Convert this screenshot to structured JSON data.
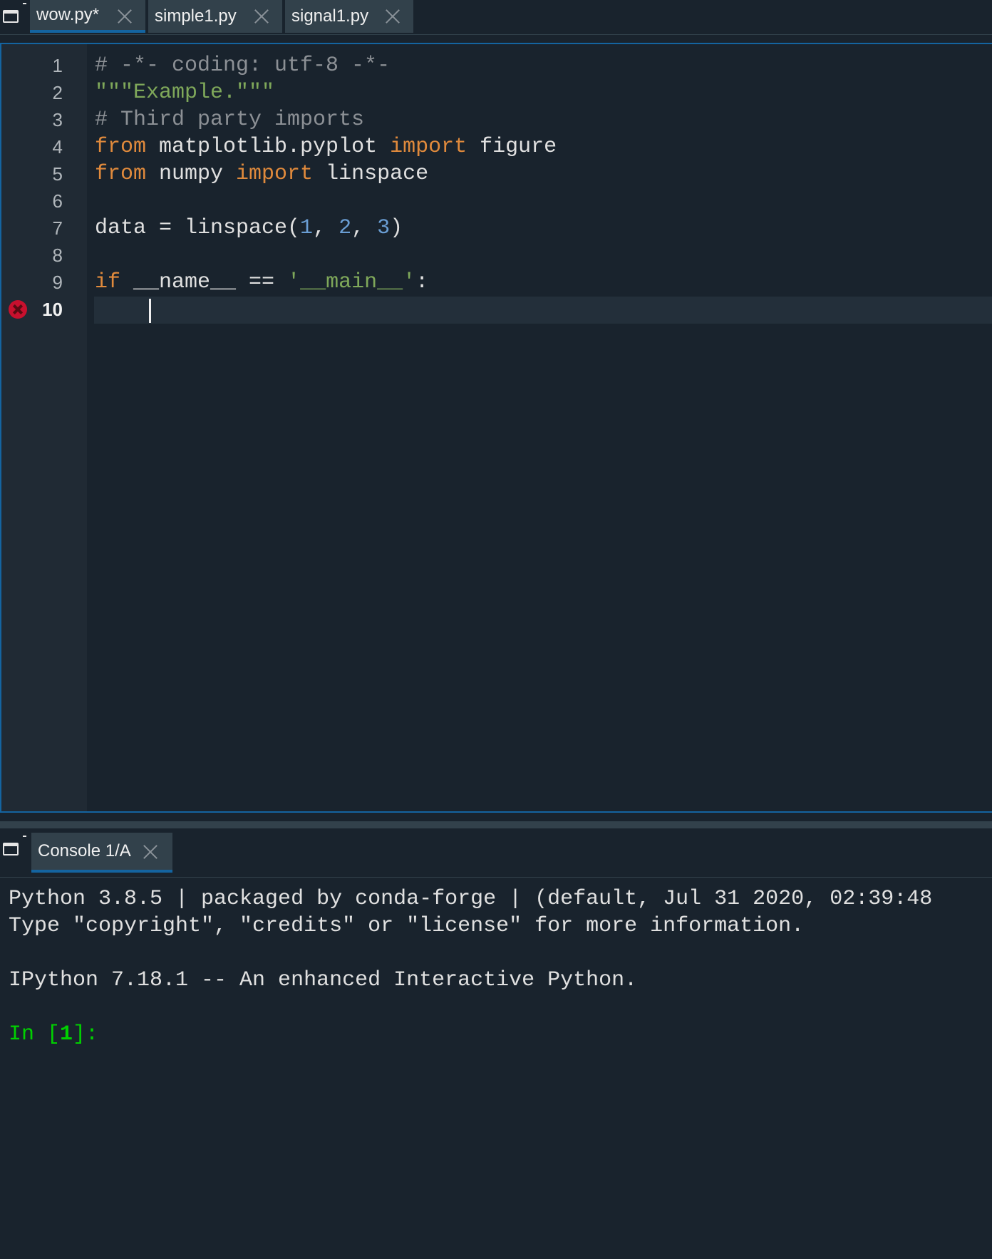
{
  "editor_tabs": [
    {
      "label": "wow.py*",
      "active": true
    },
    {
      "label": "simple1.py",
      "active": false
    },
    {
      "label": "signal1.py",
      "active": false
    }
  ],
  "editor": {
    "line_numbers": [
      "1",
      "2",
      "3",
      "4",
      "5",
      "6",
      "7",
      "8",
      "9",
      "10"
    ],
    "current_line": "10",
    "breakpoint_line": "10",
    "lines": {
      "l1": "# -*- coding: utf-8 -*-",
      "l2_q1": "\"\"\"",
      "l2_text": "Example.",
      "l2_q2": "\"\"\"",
      "l3": "# Third party imports",
      "l4_from": "from",
      "l4_mod": " matplotlib.pyplot ",
      "l4_import": "import",
      "l4_name": " figure",
      "l5_from": "from",
      "l5_mod": " numpy ",
      "l5_import": "import",
      "l5_name": " linspace",
      "l7_pre": "data = linspace(",
      "l7_n1": "1",
      "l7_sep1": ", ",
      "l7_n2": "2",
      "l7_sep2": ", ",
      "l7_n3": "3",
      "l7_post": ")",
      "l9_if": "if",
      "l9_mid": " __name__ == ",
      "l9_str": "'__main__'",
      "l9_colon": ":"
    }
  },
  "console_tabs": [
    {
      "label": "Console 1/A",
      "active": true
    }
  ],
  "console": {
    "line1": "Python 3.8.5 | packaged by conda-forge | (default, Jul 31 2020, 02:39:48",
    "line2": "Type \"copyright\", \"credits\" or \"license\" for more information.",
    "line3": "IPython 7.18.1 -- An enhanced Interactive Python.",
    "prompt_in": "In [",
    "prompt_num": "1",
    "prompt_end": "]:"
  },
  "icons": {
    "pane_menu": "window-options-icon",
    "tab_close": "close-icon",
    "breakpoint": "breakpoint-error-icon"
  },
  "colors": {
    "background": "#19232d",
    "keyword": "#e08a3c",
    "string": "#7fa85a",
    "number": "#6a9ed4",
    "comment": "#8c9095",
    "prompt": "#00d000",
    "accent": "#1464a0",
    "breakpoint": "#c8102e"
  }
}
